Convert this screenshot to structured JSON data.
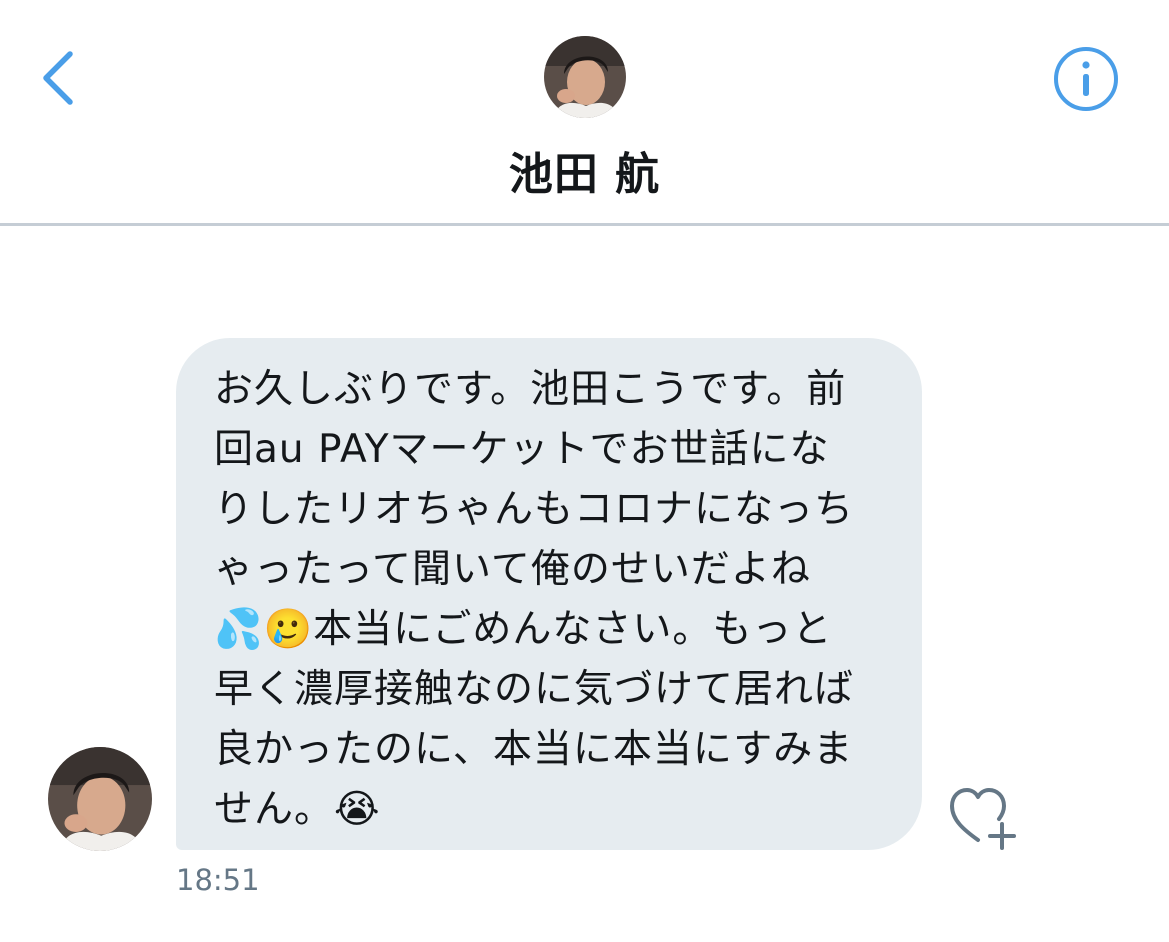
{
  "header": {
    "contact_name": "池田 航",
    "back_icon": "chevron-left-icon",
    "info_icon": "info-circle-icon",
    "accent_color": "#4a9ee8"
  },
  "message": {
    "text": "お久しぶりです。池田こうです。前\n回au PAYマーケットでお世話にな\nりしたリオちゃんもコロナになっち\nゃったって聞いて俺のせいだよね\n💦🥲本当にごめんなさい。もっと\n早く濃厚接触なのに気づけて居れば\n良かったのに、本当に本当にすみま\nせん。😭",
    "timestamp": "18:51",
    "bubble_color": "#e6ecf0",
    "like_icon": "heart-plus-icon"
  }
}
